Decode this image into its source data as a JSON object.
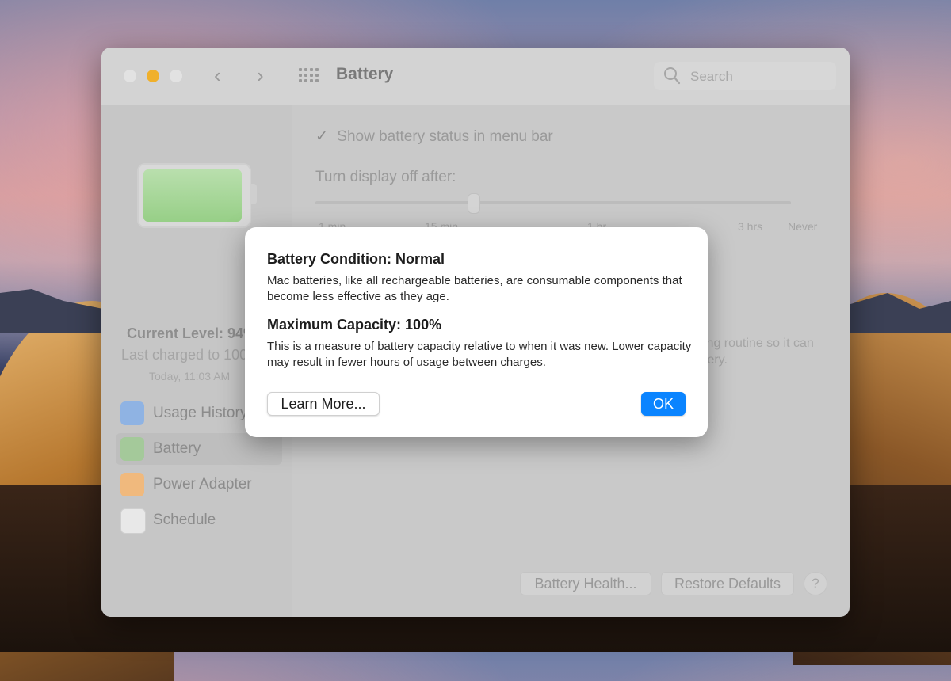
{
  "window": {
    "title": "Battery",
    "search_placeholder": "Search"
  },
  "sidebar": {
    "current_level": "Current Level: 94%",
    "last_charged": "Last charged to 100%",
    "charged_time": "Today, 11:03 AM",
    "items": [
      {
        "label": "Usage History",
        "icon": "bar-chart-icon"
      },
      {
        "label": "Battery",
        "icon": "battery-icon",
        "selected": true
      },
      {
        "label": "Power Adapter",
        "icon": "lightning-icon"
      },
      {
        "label": "Schedule",
        "icon": "calendar-icon"
      }
    ]
  },
  "main": {
    "show_status_label": "Show battery status in menu bar",
    "show_status_checked": true,
    "turn_off_label": "Turn display off after:",
    "slider_ticks": [
      "1 min",
      "15 min",
      "1 hr",
      "3 hrs",
      "Never"
    ],
    "bg_text_1": "ing routine so it can",
    "bg_text_2": "tery.",
    "battery_health_button": "Battery Health...",
    "restore_defaults_button": "Restore Defaults",
    "help_button": "?"
  },
  "dialog": {
    "condition_heading": "Battery Condition: Normal",
    "condition_body": "Mac batteries, like all rechargeable batteries, are consumable components that become less effective as they age.",
    "capacity_heading": "Maximum Capacity: 100%",
    "capacity_body": "This is a measure of battery capacity relative to when it was new. Lower capacity may result in fewer hours of usage between charges.",
    "learn_more_button": "Learn More...",
    "ok_button": "OK"
  },
  "colors": {
    "accent": "#0a84ff",
    "minimize": "#f0b02b",
    "battery_fill": "#97cf87"
  }
}
